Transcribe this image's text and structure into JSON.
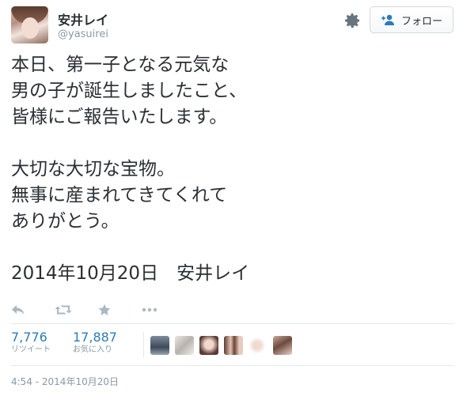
{
  "user": {
    "display_name": "安井レイ",
    "handle": "@yasuirei",
    "avatar_icon": "profile-photo"
  },
  "header": {
    "follow_label": "フォロー",
    "follow_icon": "person-add-icon",
    "settings_icon": "gear-icon"
  },
  "tweet": {
    "lines": [
      "本日、第一子となる元気な",
      "男の子が誕生しましたこと、",
      "皆様にご報告いたします。",
      "",
      "大切な大切な宝物。",
      "無事に産まれてきてくれて",
      "ありがとう。",
      "",
      "2014年10月20日　安井レイ"
    ]
  },
  "actions": [
    {
      "name": "reply-icon"
    },
    {
      "name": "retweet-icon"
    },
    {
      "name": "favorite-star-icon"
    },
    {
      "name": "more-dots-icon"
    }
  ],
  "stats": {
    "retweets": {
      "count": "7,776",
      "label": "リツイート"
    },
    "favorites": {
      "count": "17,887",
      "label": "お気に入り"
    }
  },
  "favoriters_count_shown": 6,
  "timestamp": "4:54 - 2014年10月20日",
  "colors": {
    "link": "#2b7bb9",
    "muted": "#8899a6",
    "text": "#292f33",
    "icon": "#aab8c2",
    "divider": "#e1e8ed"
  }
}
